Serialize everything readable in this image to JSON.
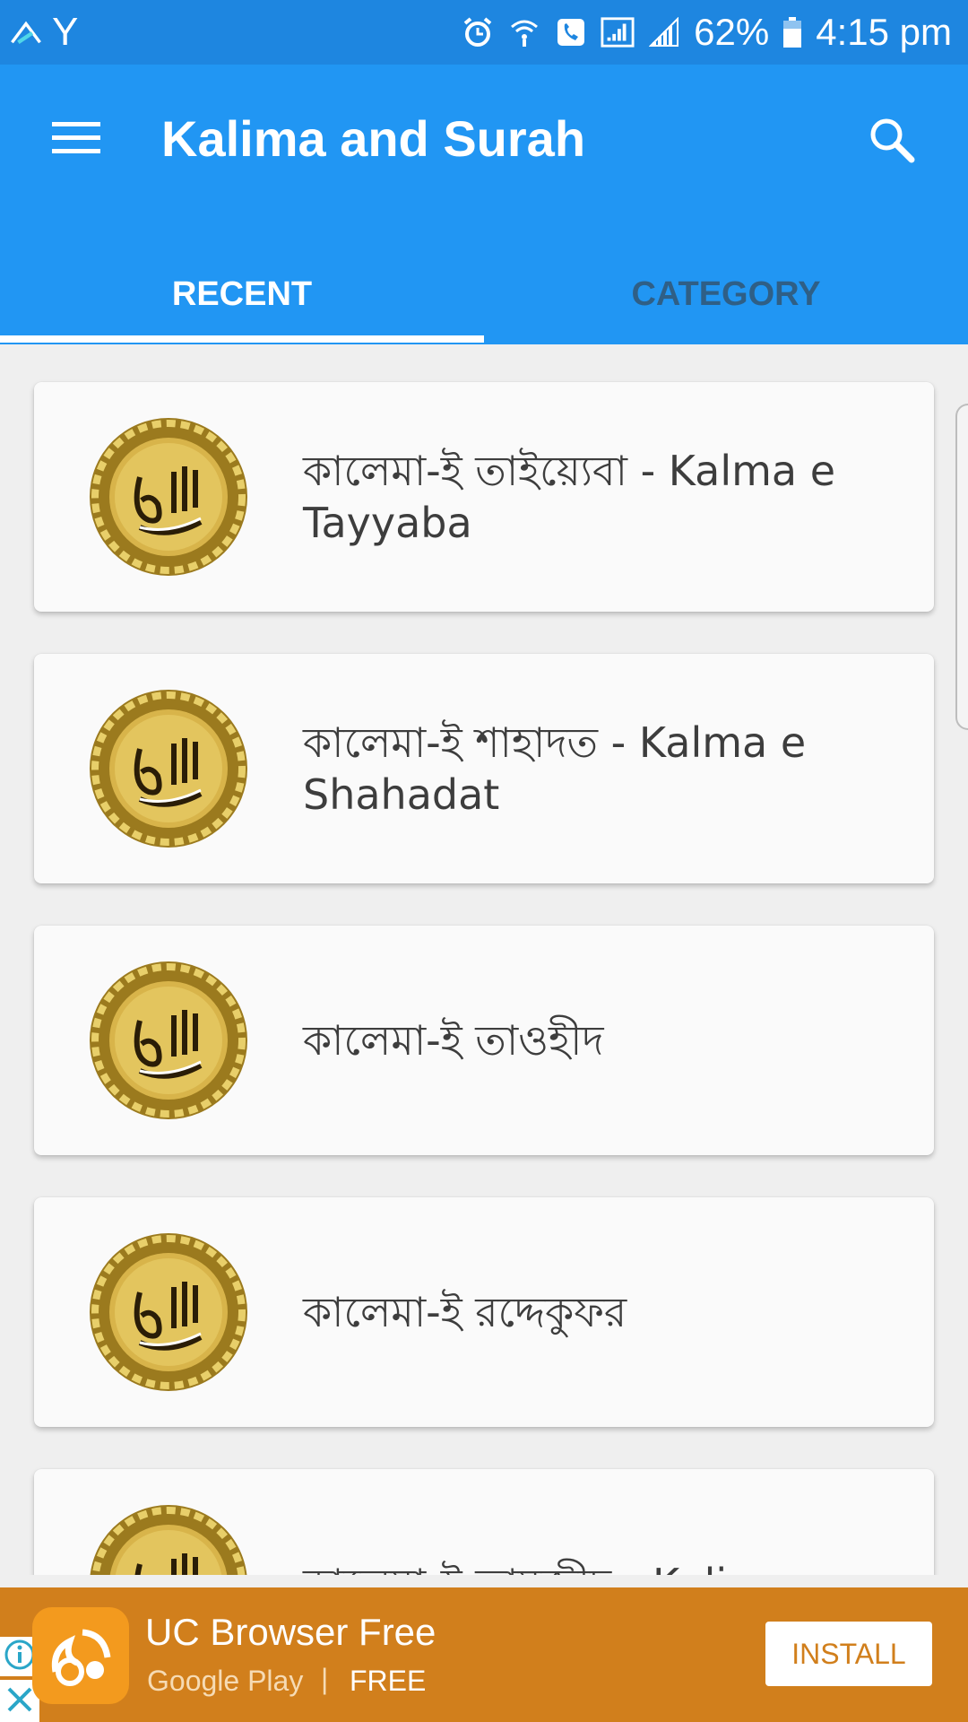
{
  "status_bar": {
    "left_icons": [
      "app-notification-icon",
      "y-notification-icon"
    ],
    "right_icons": [
      "alarm-icon",
      "wifi-call-icon",
      "phone-call-icon",
      "signal-icon",
      "signal-bars-icon",
      "battery-icon"
    ],
    "y_label": "Y",
    "battery": "62%",
    "time": "4:15 pm"
  },
  "app_bar": {
    "title": "Kalima and Surah",
    "menu_icon": "hamburger-menu-icon",
    "search_icon": "search-icon"
  },
  "tabs": [
    {
      "label": "RECENT",
      "selected": true
    },
    {
      "label": "CATEGORY",
      "selected": false
    }
  ],
  "items": [
    {
      "title": "কালেমা-ই তাইয়্যেবা - Kalma e Tayyaba"
    },
    {
      "title": "কালেমা-ই শাহাদত - Kalma e Shahadat"
    },
    {
      "title": "কালেমা-ই তাওহীদ"
    },
    {
      "title": "কালেমা-ই রদ্দেকুফর"
    },
    {
      "title": "কালেমা-ই তামজীদ - Kalima"
    }
  ],
  "ad": {
    "app_name": "UC Browser Free",
    "store": "Google Play",
    "separator": "|",
    "price": "FREE",
    "install_label": "INSTALL",
    "colors": {
      "background": "#d17f1c",
      "logo": "#f39a1e"
    }
  },
  "colors": {
    "status_bar": "#1e86e0",
    "app_bar": "#2196f3",
    "inactive_tab": "#2f5f86",
    "list_background": "#efefef",
    "card": "#fafafa"
  }
}
